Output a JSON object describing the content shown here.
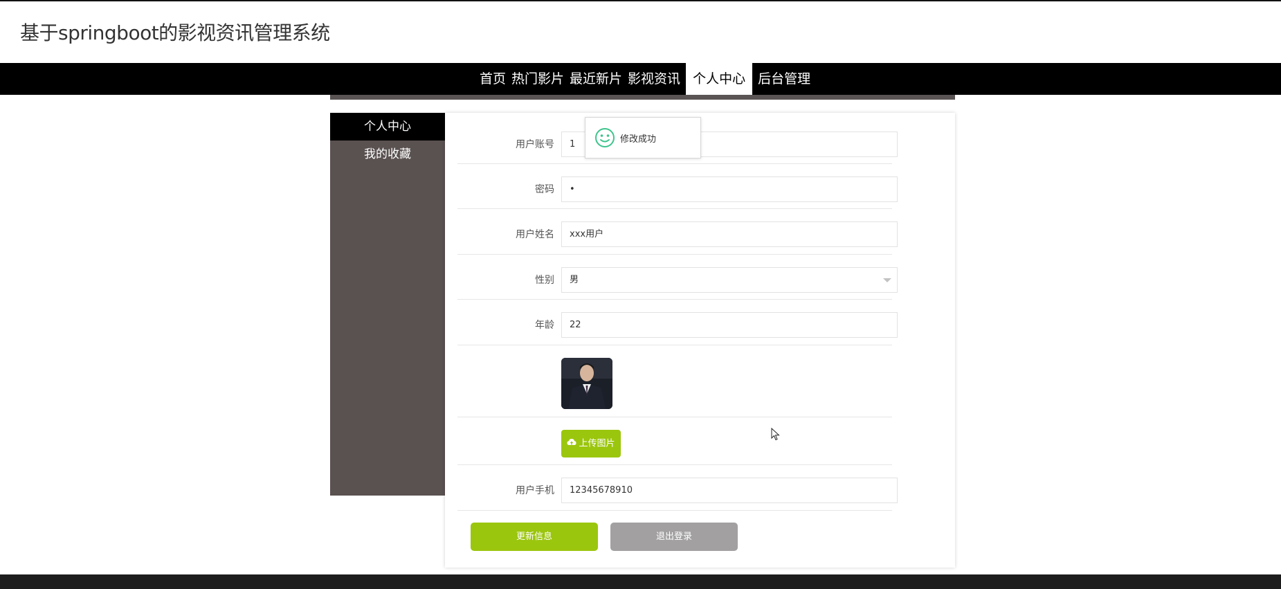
{
  "header": {
    "title": "基于springboot的影视资讯管理系统"
  },
  "nav": {
    "items": [
      {
        "label": "首页"
      },
      {
        "label": "热门影片"
      },
      {
        "label": "最近新片"
      },
      {
        "label": "影视资讯"
      },
      {
        "label": "个人中心"
      },
      {
        "label": "后台管理"
      }
    ],
    "active": "个人中心"
  },
  "sidebar": {
    "items": [
      {
        "label": "个人中心"
      },
      {
        "label": "我的收藏"
      }
    ]
  },
  "form": {
    "account": {
      "label": "用户账号",
      "value": "1"
    },
    "password": {
      "label": "密码",
      "value": "•"
    },
    "name": {
      "label": "用户姓名",
      "value": "xxx用户"
    },
    "gender": {
      "label": "性别",
      "value": "男"
    },
    "age": {
      "label": "年龄",
      "value": "22"
    },
    "upload_label": "上传图片",
    "phone": {
      "label": "用户手机",
      "value": "12345678910"
    }
  },
  "actions": {
    "update": "更新信息",
    "logout": "退出登录"
  },
  "toast": {
    "message": "修改成功"
  },
  "colors": {
    "accent": "#9bc60e",
    "nav_bg": "#000000",
    "sidebar_bg": "#5a5151",
    "toast_icon": "#3dc48c"
  }
}
